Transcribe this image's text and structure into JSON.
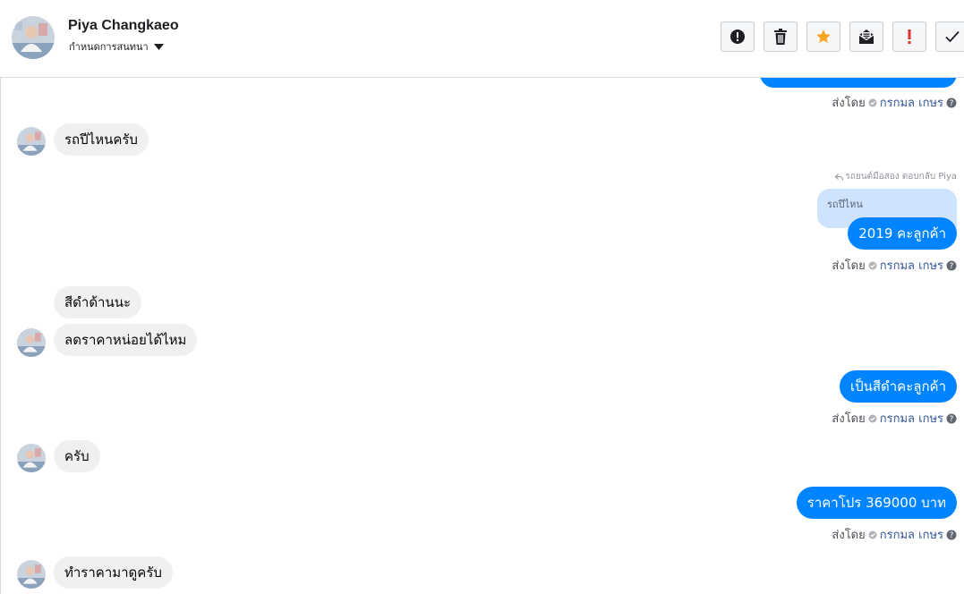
{
  "header": {
    "name": "Piya Changkaeo",
    "assign_label": "กำหนดการสนทนา"
  },
  "toolbar": [
    {
      "name": "report-spam-button",
      "icon": "exclamation-circle-icon"
    },
    {
      "name": "delete-button",
      "icon": "trash-icon"
    },
    {
      "name": "star-button",
      "icon": "star-icon",
      "color": "#f5a623"
    },
    {
      "name": "mark-unread-button",
      "icon": "envelope-open-icon"
    },
    {
      "name": "follow-up-button",
      "icon": "exclamation-icon",
      "color": "#e02f2f"
    },
    {
      "name": "mark-done-button",
      "icon": "check-icon"
    }
  ],
  "sent_by": {
    "prefix": "ส่งโดย",
    "name": "กรกมล เกษร"
  },
  "reply_caption": "รถยนต์มือสอง ตอบกลับ Piya",
  "quote_text": "รถปีไหน",
  "messages": [
    {
      "dir": "in",
      "text": "รถปีไหนครับ"
    },
    {
      "dir": "out",
      "text": "2019 คะลูกค้า"
    },
    {
      "dir": "in",
      "text": "สีดำด้านนะ"
    },
    {
      "dir": "in",
      "text": "ลดราคาหน่อยได้ไหม"
    },
    {
      "dir": "out",
      "text": "เป็นสีดำคะลูกค้า"
    },
    {
      "dir": "in",
      "text": "ครับ"
    },
    {
      "dir": "out",
      "text": "ราคาโปร 369000 บาท"
    },
    {
      "dir": "in",
      "text": "ทำราคามาดูครับ"
    }
  ],
  "colors": {
    "outgoing_bubble": "#0084ff",
    "incoming_bubble": "#f1f0f0",
    "quote_bubble": "#cfe3fd",
    "sender_link": "#365899"
  }
}
